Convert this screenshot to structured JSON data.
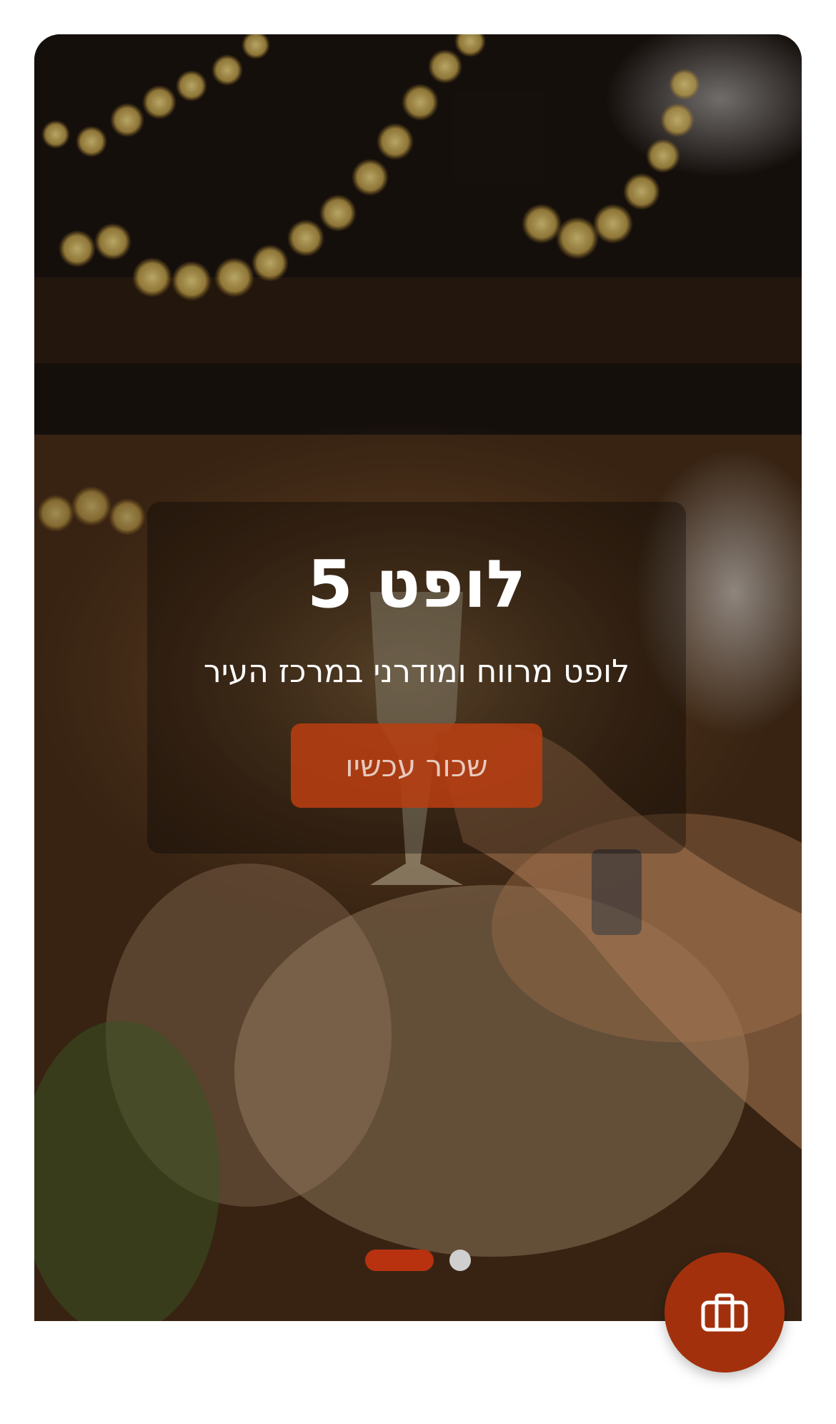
{
  "hero": {
    "title": "לופט 5",
    "subtitle": "לופט מרווח ומודרני במרכז העיר",
    "cta_label": "שכור עכשיו"
  },
  "carousel": {
    "slide_count": 2,
    "active_index": 0
  },
  "fab": {
    "icon": "briefcase-icon"
  },
  "colors": {
    "accent": "#b83210",
    "fab": "#a3300c",
    "inactive_dot": "#cfcfcf"
  }
}
